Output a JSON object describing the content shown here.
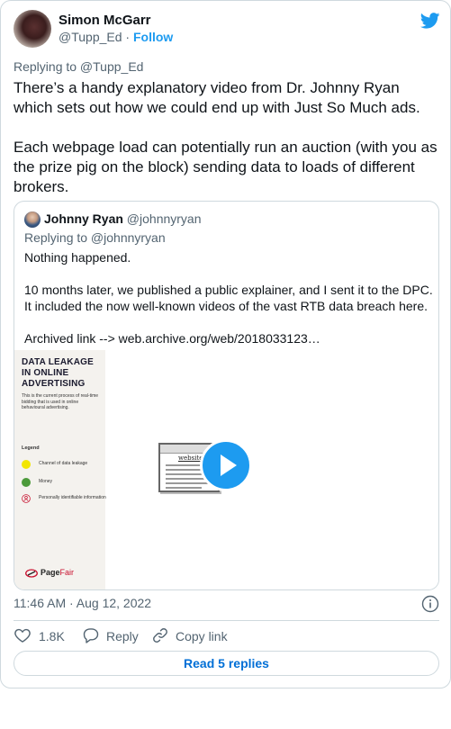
{
  "author": {
    "name": "Simon McGarr",
    "handle": "@Tupp_Ed",
    "separator": "·",
    "follow_label": "Follow"
  },
  "replying_to": "Replying to @Tupp_Ed",
  "tweet_text": [
    "There’s a handy explanatory video from Dr. Johnny Ryan which sets out how we could end up with Just So Much ads.",
    "Each webpage load can potentially run an auction (with you as the prize pig on the block) sending data to loads of different brokers."
  ],
  "quote": {
    "name": "Johnny Ryan",
    "handle": "@johnnyryan",
    "replying_to": "Replying to @johnnyryan",
    "lines": [
      "Nothing happened.",
      "10 months later, we published a public explainer, and I sent it to the DPC.",
      "It included the now well-known videos of the vast RTB data breach here.",
      "Archived link --> web.archive.org/web/2018033123…"
    ],
    "media": {
      "title": "DATA LEAKAGE IN ONLINE ADVERTISING",
      "subtitle": "This is the current process of real-time bidding that is used in online behavioural advertising.",
      "legend_title": "Legend",
      "legend": [
        {
          "label": "Channel of data leakage",
          "color": "#f2e600"
        },
        {
          "label": "Money",
          "color": "#4c9a3b"
        },
        {
          "label": "Personally identifiable information",
          "color": "#c8102e"
        }
      ],
      "logo": {
        "brand": "Page",
        "suffix": "Fair"
      },
      "website_label": "website.c"
    }
  },
  "timestamp": "11:46 AM · Aug 12, 2022",
  "actions": {
    "likes": "1.8K",
    "reply_label": "Reply",
    "copy_label": "Copy link"
  },
  "read_replies_label": "Read 5 replies",
  "colors": {
    "accent": "#1d9bf0",
    "secondary_text": "#536471",
    "border": "#cfd9de",
    "link_button": "#006fd6"
  },
  "icons": [
    "twitter-bird-icon",
    "play-icon",
    "info-icon",
    "heart-icon",
    "reply-bubble-icon",
    "link-icon"
  ]
}
